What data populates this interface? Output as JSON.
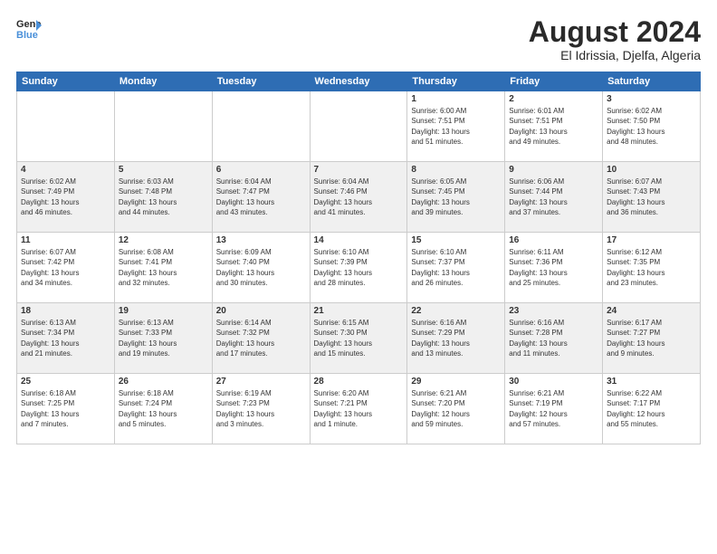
{
  "logo": {
    "line1": "General",
    "line2": "Blue"
  },
  "title": "August 2024",
  "location": "El Idrissia, Djelfa, Algeria",
  "weekdays": [
    "Sunday",
    "Monday",
    "Tuesday",
    "Wednesday",
    "Thursday",
    "Friday",
    "Saturday"
  ],
  "weeks": [
    [
      {
        "day": "",
        "info": ""
      },
      {
        "day": "",
        "info": ""
      },
      {
        "day": "",
        "info": ""
      },
      {
        "day": "",
        "info": ""
      },
      {
        "day": "1",
        "info": "Sunrise: 6:00 AM\nSunset: 7:51 PM\nDaylight: 13 hours\nand 51 minutes."
      },
      {
        "day": "2",
        "info": "Sunrise: 6:01 AM\nSunset: 7:51 PM\nDaylight: 13 hours\nand 49 minutes."
      },
      {
        "day": "3",
        "info": "Sunrise: 6:02 AM\nSunset: 7:50 PM\nDaylight: 13 hours\nand 48 minutes."
      }
    ],
    [
      {
        "day": "4",
        "info": "Sunrise: 6:02 AM\nSunset: 7:49 PM\nDaylight: 13 hours\nand 46 minutes."
      },
      {
        "day": "5",
        "info": "Sunrise: 6:03 AM\nSunset: 7:48 PM\nDaylight: 13 hours\nand 44 minutes."
      },
      {
        "day": "6",
        "info": "Sunrise: 6:04 AM\nSunset: 7:47 PM\nDaylight: 13 hours\nand 43 minutes."
      },
      {
        "day": "7",
        "info": "Sunrise: 6:04 AM\nSunset: 7:46 PM\nDaylight: 13 hours\nand 41 minutes."
      },
      {
        "day": "8",
        "info": "Sunrise: 6:05 AM\nSunset: 7:45 PM\nDaylight: 13 hours\nand 39 minutes."
      },
      {
        "day": "9",
        "info": "Sunrise: 6:06 AM\nSunset: 7:44 PM\nDaylight: 13 hours\nand 37 minutes."
      },
      {
        "day": "10",
        "info": "Sunrise: 6:07 AM\nSunset: 7:43 PM\nDaylight: 13 hours\nand 36 minutes."
      }
    ],
    [
      {
        "day": "11",
        "info": "Sunrise: 6:07 AM\nSunset: 7:42 PM\nDaylight: 13 hours\nand 34 minutes."
      },
      {
        "day": "12",
        "info": "Sunrise: 6:08 AM\nSunset: 7:41 PM\nDaylight: 13 hours\nand 32 minutes."
      },
      {
        "day": "13",
        "info": "Sunrise: 6:09 AM\nSunset: 7:40 PM\nDaylight: 13 hours\nand 30 minutes."
      },
      {
        "day": "14",
        "info": "Sunrise: 6:10 AM\nSunset: 7:39 PM\nDaylight: 13 hours\nand 28 minutes."
      },
      {
        "day": "15",
        "info": "Sunrise: 6:10 AM\nSunset: 7:37 PM\nDaylight: 13 hours\nand 26 minutes."
      },
      {
        "day": "16",
        "info": "Sunrise: 6:11 AM\nSunset: 7:36 PM\nDaylight: 13 hours\nand 25 minutes."
      },
      {
        "day": "17",
        "info": "Sunrise: 6:12 AM\nSunset: 7:35 PM\nDaylight: 13 hours\nand 23 minutes."
      }
    ],
    [
      {
        "day": "18",
        "info": "Sunrise: 6:13 AM\nSunset: 7:34 PM\nDaylight: 13 hours\nand 21 minutes."
      },
      {
        "day": "19",
        "info": "Sunrise: 6:13 AM\nSunset: 7:33 PM\nDaylight: 13 hours\nand 19 minutes."
      },
      {
        "day": "20",
        "info": "Sunrise: 6:14 AM\nSunset: 7:32 PM\nDaylight: 13 hours\nand 17 minutes."
      },
      {
        "day": "21",
        "info": "Sunrise: 6:15 AM\nSunset: 7:30 PM\nDaylight: 13 hours\nand 15 minutes."
      },
      {
        "day": "22",
        "info": "Sunrise: 6:16 AM\nSunset: 7:29 PM\nDaylight: 13 hours\nand 13 minutes."
      },
      {
        "day": "23",
        "info": "Sunrise: 6:16 AM\nSunset: 7:28 PM\nDaylight: 13 hours\nand 11 minutes."
      },
      {
        "day": "24",
        "info": "Sunrise: 6:17 AM\nSunset: 7:27 PM\nDaylight: 13 hours\nand 9 minutes."
      }
    ],
    [
      {
        "day": "25",
        "info": "Sunrise: 6:18 AM\nSunset: 7:25 PM\nDaylight: 13 hours\nand 7 minutes."
      },
      {
        "day": "26",
        "info": "Sunrise: 6:18 AM\nSunset: 7:24 PM\nDaylight: 13 hours\nand 5 minutes."
      },
      {
        "day": "27",
        "info": "Sunrise: 6:19 AM\nSunset: 7:23 PM\nDaylight: 13 hours\nand 3 minutes."
      },
      {
        "day": "28",
        "info": "Sunrise: 6:20 AM\nSunset: 7:21 PM\nDaylight: 13 hours\nand 1 minute."
      },
      {
        "day": "29",
        "info": "Sunrise: 6:21 AM\nSunset: 7:20 PM\nDaylight: 12 hours\nand 59 minutes."
      },
      {
        "day": "30",
        "info": "Sunrise: 6:21 AM\nSunset: 7:19 PM\nDaylight: 12 hours\nand 57 minutes."
      },
      {
        "day": "31",
        "info": "Sunrise: 6:22 AM\nSunset: 7:17 PM\nDaylight: 12 hours\nand 55 minutes."
      }
    ]
  ]
}
